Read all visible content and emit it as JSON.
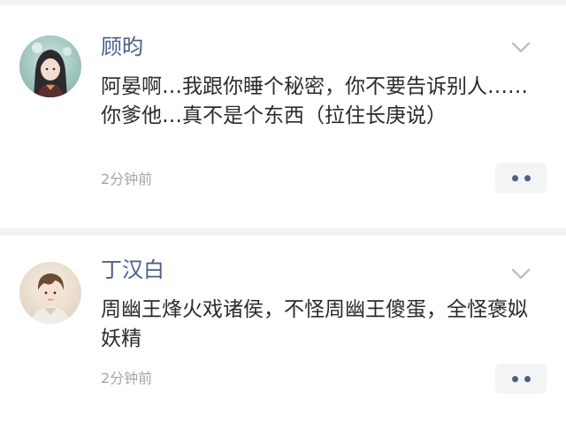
{
  "comments": [
    {
      "username": "顾昀",
      "text": "阿晏啊…我跟你睡个秘密，你不要告诉别人……你爹他…真不是个东西（拉住长庚说）",
      "time": "2分钟前",
      "avatar_icon": "avatar-long-hair-character",
      "menu_icon": "chevron-down-icon",
      "more_icon": "more-dots-icon"
    },
    {
      "username": "丁汉白",
      "text": "周幽王烽火戏诸侯，不怪周幽王傻蛋，全怪褒姒妖精",
      "time": "2分钟前",
      "avatar_icon": "avatar-short-hair-character",
      "menu_icon": "chevron-down-icon",
      "more_icon": "more-dots-icon"
    }
  ],
  "colors": {
    "username": "#4a5f89",
    "text": "#2b2b2b",
    "time": "#a6a6a6",
    "more_button_bg": "#f2f4f6",
    "divider": "#f2f2f2"
  }
}
